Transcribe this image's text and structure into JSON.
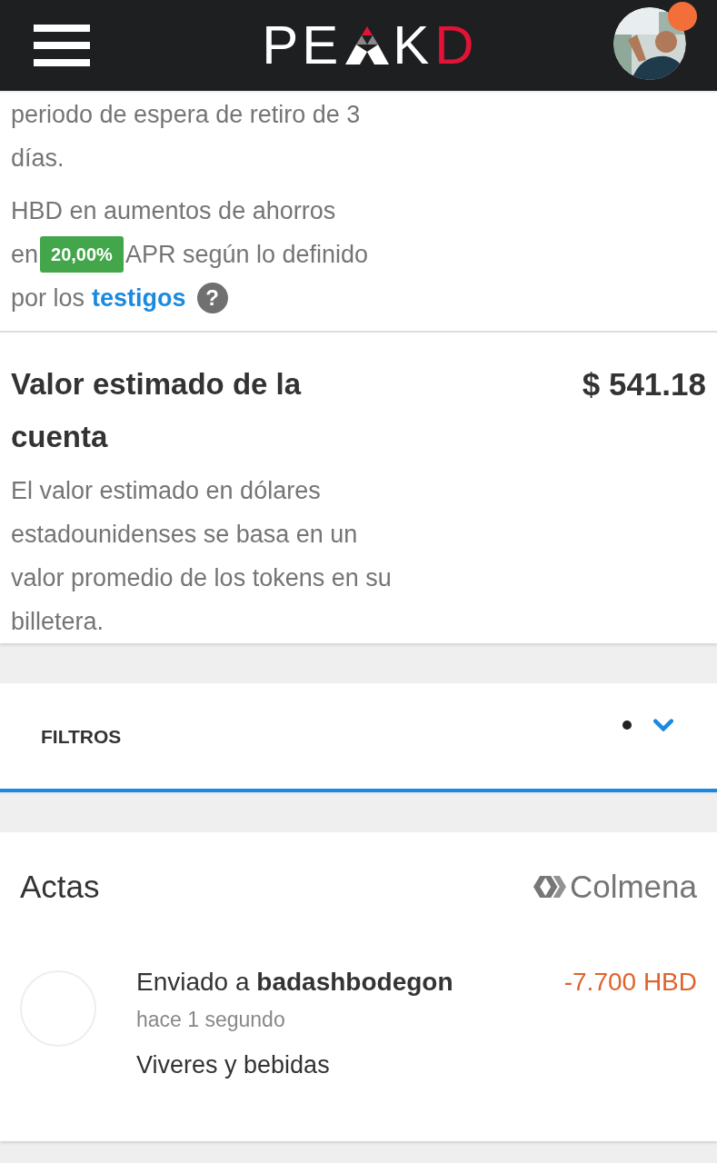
{
  "header": {
    "logo": {
      "lead": "PE",
      "middle": "K",
      "accent": "D"
    },
    "avatar": {
      "kind": "picture",
      "notification": true
    }
  },
  "savings": {
    "tail": "periodo de espera de retiro de 3 días.",
    "apr_line": "HBD en aumentos de ahorros",
    "apr_before": "en",
    "apr_badge": "20,00%",
    "apr_after": "APR según lo definido",
    "link_before": "por los",
    "link": "testigos",
    "help": "?"
  },
  "estimate": {
    "title": "Valor estimado de la cuenta",
    "value": "$ 541.18",
    "description": "El valor estimado en dólares estadounidenses se basa en un valor promedio de los tokens en su billetera."
  },
  "filters": {
    "label": "FILTROS",
    "active": true,
    "expanded": false
  },
  "transactions": {
    "title": "Actas",
    "network": "Colmena",
    "items": [
      {
        "text": "Enviado a **badashbodegon**",
        "amount": "-7.700 HBD",
        "negative": true,
        "time": "hace 1 segundo",
        "memo": "Viveres y bebidas"
      }
    ]
  }
}
